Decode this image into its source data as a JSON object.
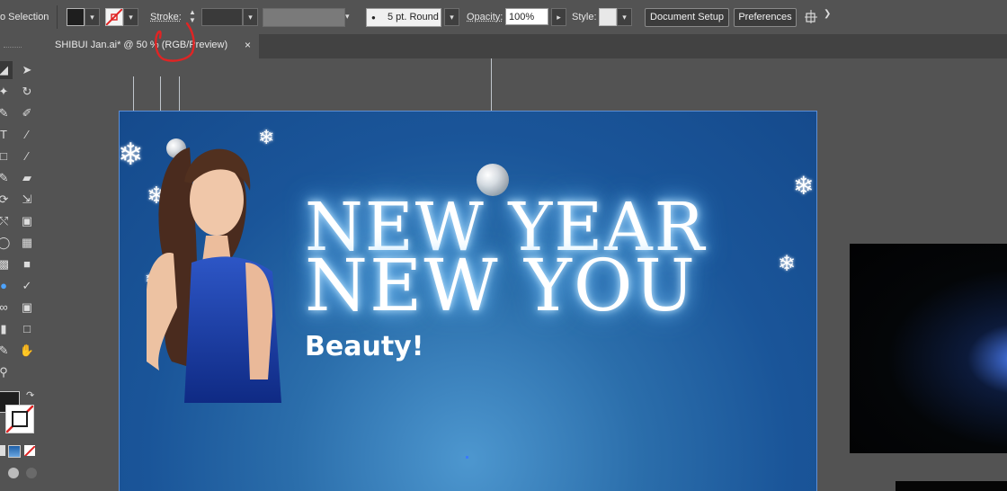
{
  "control_bar": {
    "selection_label": "o Selection",
    "stroke_label": "Stroke:",
    "brush_value": "5 pt. Round",
    "opacity_label": "Opacity:",
    "opacity_value": "100%",
    "style_label": "Style:",
    "document_setup_label": "Document Setup",
    "preferences_label": "Preferences"
  },
  "document_tab": {
    "title": "SHIBUI Jan.ai* @ 50 % (RGB/Preview)",
    "close_glyph": "×"
  },
  "artboard": {
    "headline_line1": "NEW YEAR",
    "headline_line2": "NEW YOU",
    "subtext": "Beauty!"
  },
  "colors": {
    "fill_swatch": "#1e1e1e",
    "artboard_blue": "#1a5599",
    "glow": "#8fd0ff",
    "annotation_red": "#e02424"
  },
  "icons": [
    "selection-tool-icon",
    "direct-selection-tool-icon",
    "magic-wand-icon",
    "lasso-icon",
    "pen-icon",
    "curvature-icon",
    "type-icon",
    "line-icon",
    "rectangle-icon",
    "paintbrush-icon",
    "shaper-icon",
    "eraser-icon",
    "rotate-icon",
    "scale-icon",
    "width-icon",
    "free-transform-icon",
    "shape-builder-icon",
    "perspective-icon",
    "mesh-icon",
    "gradient-icon",
    "eyedropper-icon",
    "blend-icon",
    "symbol-sprayer-icon",
    "graph-icon",
    "artboard-tool-icon",
    "slice-icon",
    "eraser-icon-2",
    "hand-icon",
    "zoom-icon"
  ]
}
